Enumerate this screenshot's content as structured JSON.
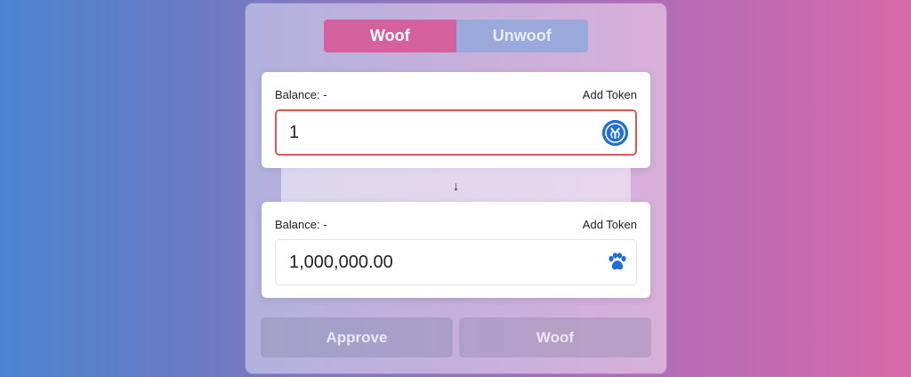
{
  "tabs": {
    "active": "Woof",
    "inactive": "Unwoof"
  },
  "from": {
    "balance": "Balance: -",
    "add_token": "Add Token",
    "amount": "1",
    "token_icon": "yearn-token-icon"
  },
  "arrow": "↓",
  "to": {
    "balance": "Balance: -",
    "add_token": "Add Token",
    "amount": "1,000,000.00",
    "token_icon": "paw-icon"
  },
  "actions": {
    "approve": "Approve",
    "woof": "Woof"
  },
  "colors": {
    "accent": "#d4609e",
    "inactive_tab": "#9aa8dc",
    "error_border": "#e0574f",
    "token_blue": "#1f6fd6"
  }
}
